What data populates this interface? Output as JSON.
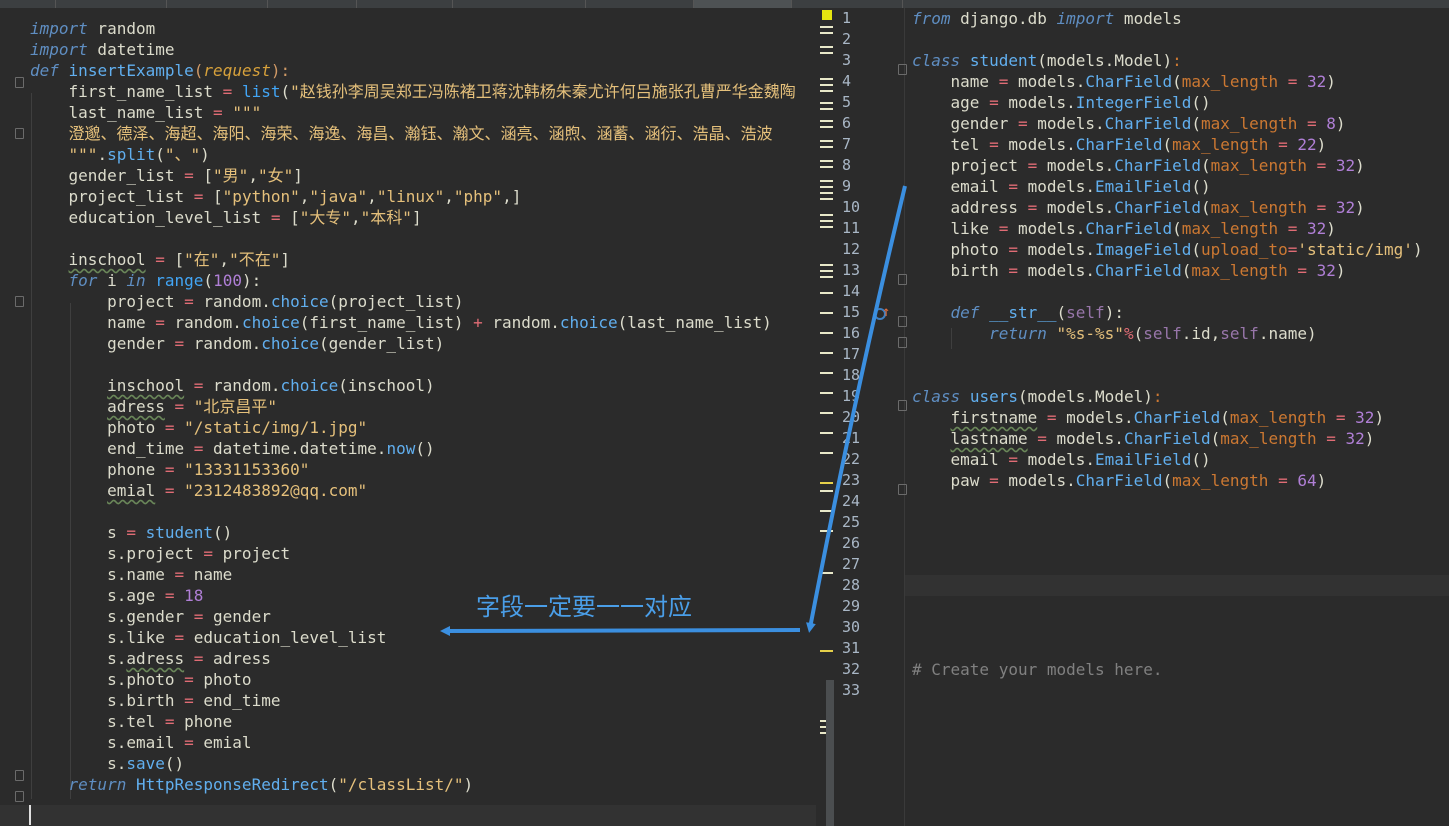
{
  "left_editor": {
    "lines": [
      "",
      "import random",
      "import datetime",
      "def insertExample(request):",
      "    first_name_list = list(\"赵钱孙李周吴郑王冯陈褚卫蒋沈韩杨朱秦尤许何吕施张孔曹严华金魏陶",
      "    last_name_list = \"\"\"",
      "    澄邈、德泽、海超、海阳、海荣、海逸、海昌、瀚钰、瀚文、涵亮、涵煦、涵蓄、涵衍、浩晶、浩波",
      "    \"\"\".split(\"、\")",
      "    gender_list = [\"男\",\"女\"]",
      "    project_list = [\"python\",\"java\",\"linux\",\"php\",]",
      "    education_level_list = [\"大专\",\"本科\"]",
      "",
      "    inschool = [\"在\",\"不在\"]",
      "    for i in range(100):",
      "        project = random.choice(project_list)",
      "        name = random.choice(first_name_list) + random.choice(last_name_list)",
      "        gender = random.choice(gender_list)",
      "",
      "        inschool = random.choice(inschool)",
      "        adress = \"北京昌平\"",
      "        photo = \"/static/img/1.jpg\"",
      "        end_time = datetime.datetime.now()",
      "        phone = \"13331153360\"",
      "        emial = \"2312483892@qq.com\"",
      "",
      "        s = student()",
      "        s.project = project",
      "        s.name = name",
      "        s.age = 18",
      "        s.gender = gender",
      "        s.like = education_level_list",
      "        s.adress = adress",
      "        s.photo = photo",
      "        s.birth = end_time",
      "        s.tel = phone",
      "        s.email = emial",
      "        s.save()",
      "    return HttpResponseRedirect(\"/classList/\")",
      ""
    ]
  },
  "right_editor": {
    "line_numbers": [
      "1",
      "2",
      "3",
      "4",
      "5",
      "6",
      "7",
      "8",
      "9",
      "10",
      "11",
      "12",
      "13",
      "14",
      "15",
      "16",
      "17",
      "18",
      "19",
      "20",
      "21",
      "22",
      "23",
      "24",
      "25",
      "26",
      "27",
      "28",
      "29",
      "30",
      "31",
      "32",
      "33"
    ],
    "lines": [
      "from django.db import models",
      "",
      "class student(models.Model):",
      "    name = models.CharField(max_length = 32)",
      "    age = models.IntegerField()",
      "    gender = models.CharField(max_length = 8)",
      "    tel = models.CharField(max_length = 22)",
      "    project = models.CharField(max_length = 32)",
      "    email = models.EmailField()",
      "    address = models.CharField(max_length = 32)",
      "    like = models.CharField(max_length = 32)",
      "    photo = models.ImageField(upload_to='static/img')",
      "    birth = models.CharField(max_length = 32)",
      "",
      "    def __str__(self):",
      "        return \"%s-%s\"%(self.id,self.name)",
      "",
      "",
      "class users(models.Model):",
      "    firstname = models.CharField(max_length = 32)",
      "    lastname = models.CharField(max_length = 32)",
      "    email = models.EmailField()",
      "    paw = models.CharField(max_length = 64)",
      "",
      "",
      "",
      "",
      "",
      "",
      "",
      "",
      "# Create your models here.",
      ""
    ]
  },
  "annotation": {
    "text": "字段一定要一一对应",
    "arrow_color": "#3b8fe0"
  }
}
